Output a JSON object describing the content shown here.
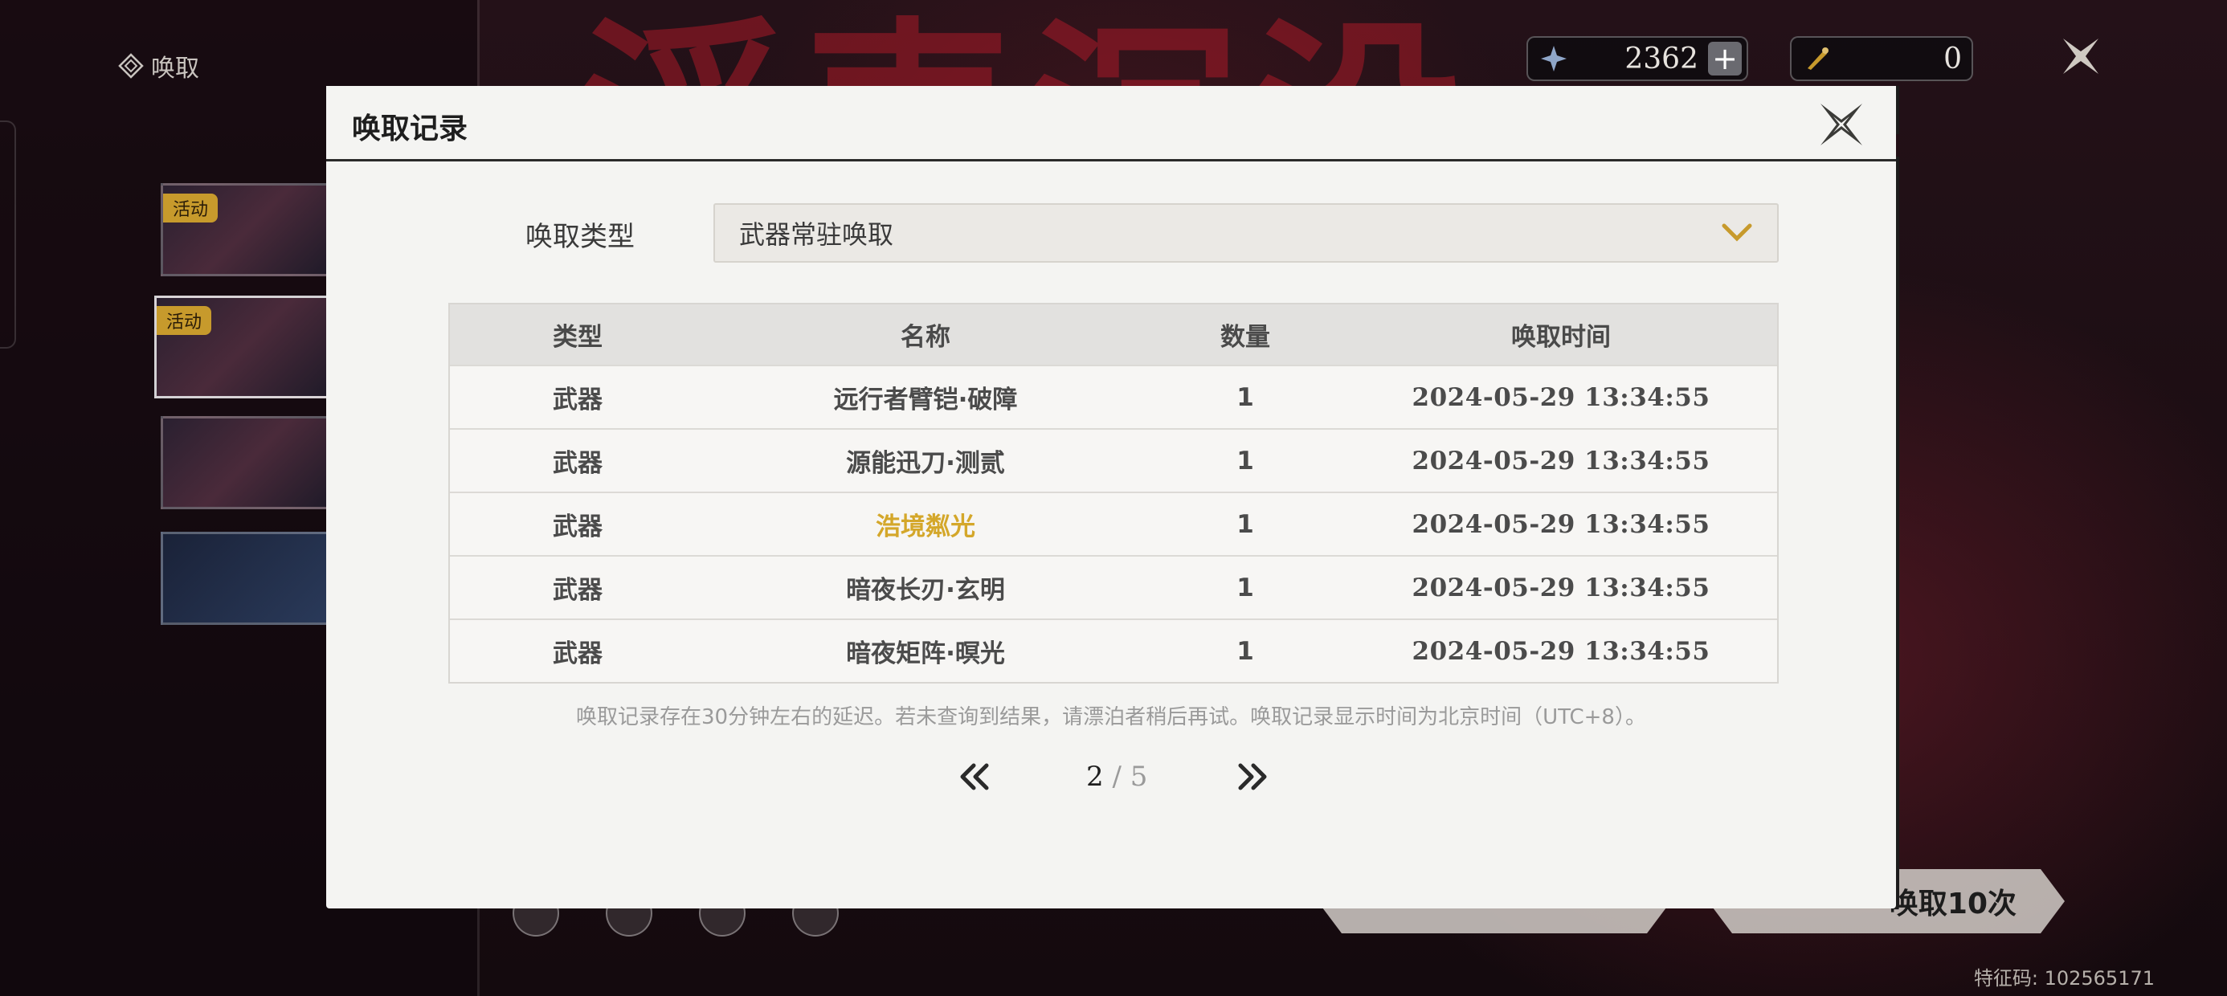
{
  "background": {
    "sidebar_title": "唤取",
    "banners": [
      {
        "tag": "活动"
      },
      {
        "tag": "活动"
      },
      {
        "tag": ""
      },
      {
        "tag": ""
      }
    ],
    "currency": [
      {
        "icon": "astrite-icon",
        "value": "2362"
      },
      {
        "icon": "forging-tide-icon",
        "value": "0"
      }
    ],
    "pull_ten_label": "唤取10次",
    "uid_label": "特征码: 102565171"
  },
  "modal": {
    "title": "唤取记录",
    "type_label": "唤取类型",
    "type_value": "武器常驻唤取",
    "table": {
      "headers": [
        "类型",
        "名称",
        "数量",
        "唤取时间"
      ],
      "rows": [
        {
          "type": "武器",
          "name": "远行者臂铠·破障",
          "count": "1",
          "time": "2024-05-29 13:34:55"
        },
        {
          "type": "武器",
          "name": "源能迅刀·测贰",
          "count": "1",
          "time": "2024-05-29 13:34:55"
        },
        {
          "type": "武器",
          "name": "浩境粼光",
          "count": "1",
          "time": "2024-05-29 13:34:55"
        },
        {
          "type": "武器",
          "name": "暗夜长刃·玄明",
          "count": "1",
          "time": "2024-05-29 13:34:55"
        },
        {
          "type": "武器",
          "name": "暗夜矩阵·暝光",
          "count": "1",
          "time": "2024-05-29 13:34:55"
        }
      ]
    },
    "note": "唤取记录存在30分钟左右的延迟。若未查询到结果，请漂泊者稍后再试。唤取记录显示时间为北京时间（UTC+8）。",
    "pagination": {
      "current": "2",
      "total": "/ 5"
    }
  },
  "colors": {
    "gold_highlight": "#d4a72a",
    "modal_bg": "#f4f4f2",
    "table_head": "#e2e1df"
  }
}
